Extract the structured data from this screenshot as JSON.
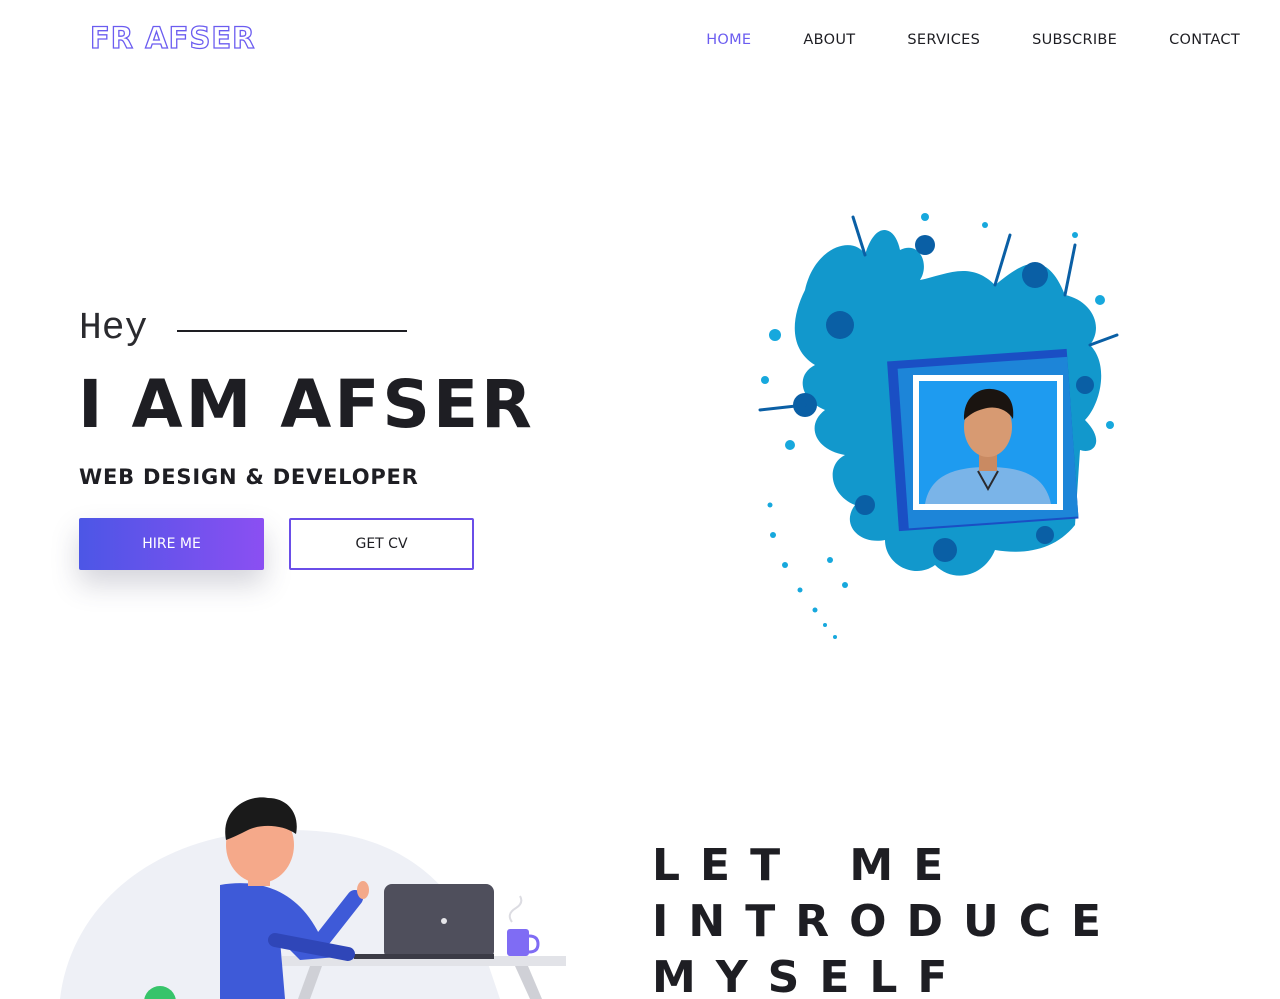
{
  "brand": {
    "logo_text": "FR AFSER",
    "accent_color": "#6b5cf0"
  },
  "nav": {
    "items": [
      {
        "label": "HOME",
        "active": true
      },
      {
        "label": "ABOUT",
        "active": false
      },
      {
        "label": "SERVICES",
        "active": false
      },
      {
        "label": "SUBSCRIBE",
        "active": false
      },
      {
        "label": "CONTACT",
        "active": false
      }
    ]
  },
  "hero": {
    "greeting": "Hey",
    "name": "I AM AFSER",
    "role": "WEB DESIGN & DEVELOPER",
    "hire_button": "HIRE ME",
    "cv_button": "GET CV",
    "button_gradient": [
      "#4c56e6",
      "#8b4ff2"
    ],
    "splash_color": "#0d8bc4"
  },
  "about": {
    "title": "LET ME INTRODUCE MYSELF"
  },
  "icons": {
    "profile_photo": "profile-photo",
    "illustration": "developer-at-desk-illustration"
  }
}
